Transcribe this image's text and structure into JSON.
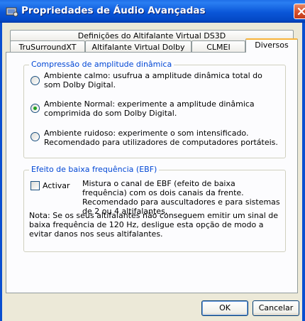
{
  "window": {
    "title": "Propriedades de Áudio Avançadas"
  },
  "tabs": {
    "row_top": [
      {
        "label": "Definições do Altifalante Virtual DS3D"
      }
    ],
    "row_bottom": [
      {
        "label": "TruSurroundXT"
      },
      {
        "label": "Altifalante Virtual Dolby"
      },
      {
        "label": "CLMEI"
      },
      {
        "label": "Diversos"
      }
    ],
    "active": "Diversos"
  },
  "drc_group": {
    "legend": "Compressão de amplitude dinâmica",
    "options": [
      {
        "text": "Ambiente calmo: usufrua a amplitude dinâmica total do som Dolby Digital.",
        "selected": false
      },
      {
        "text": "Ambiente Normal: experimente a amplitude dinâmica comprimida do som Dolby Digital.",
        "selected": true
      },
      {
        "text": "Ambiente ruidoso: experimente o som intensificado. Recomendado para utilizadores de computadores portáteis.",
        "selected": false
      }
    ]
  },
  "lfe_group": {
    "legend": "Efeito de baixa frequência (EBF)",
    "checkbox_label": "Activar",
    "checked": false,
    "description": "Mistura o canal de EBF (efeito de baixa frequência) com os dois canais da frente. Recomendado para auscultadores e para sistemas de 2 ou 4 altifalantes.",
    "note": "Nota: Se os seus altifalantes não conseguem emitir um sinal de baixa frequência de 120 Hz, desligue esta opção de modo a evitar danos nos seus altifalantes."
  },
  "buttons": {
    "ok": "OK",
    "cancel": "Cancelar"
  },
  "colors": {
    "titlebar": "#0a56d8",
    "legend": "#0046d5",
    "radio_dot": "#21a121",
    "tab_highlight": "#f8b43a"
  }
}
